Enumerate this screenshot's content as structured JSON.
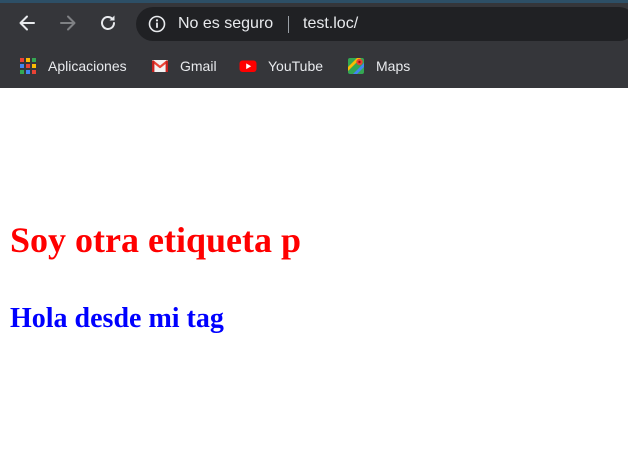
{
  "browser": {
    "omnibox": {
      "security_text": "No es seguro",
      "url": "test.loc/"
    },
    "bookmarks": [
      {
        "label": "Aplicaciones",
        "icon": "apps-grid-icon"
      },
      {
        "label": "Gmail",
        "icon": "gmail-icon"
      },
      {
        "label": "YouTube",
        "icon": "youtube-icon"
      },
      {
        "label": "Maps",
        "icon": "maps-icon"
      }
    ],
    "colors": {
      "frame": "#35363a",
      "omnibox": "#202124",
      "text": "#e8eaed"
    }
  },
  "page": {
    "paragraph_1": {
      "text": "Soy otra etiqueta p",
      "color": "#ff0000"
    },
    "paragraph_2": {
      "text": "Hola desde mi tag",
      "color": "#0000ff"
    }
  }
}
